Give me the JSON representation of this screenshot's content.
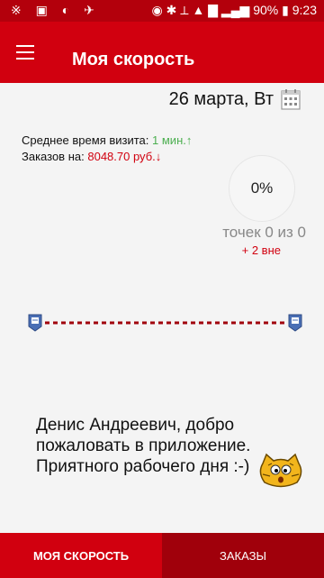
{
  "status_bar": {
    "battery": "90%",
    "time": "9:23"
  },
  "app_bar": {
    "title": "Моя скорость"
  },
  "date": {
    "text": "26 марта, Вт"
  },
  "stats": {
    "avg_visit_label": "Среднее время визита:",
    "avg_visit_value": "1 мин.↑",
    "orders_label": "Заказов на:",
    "orders_value": "8048.70 руб.↓"
  },
  "progress": {
    "percent_text": "0%",
    "percent": 0
  },
  "points": {
    "text": "точек 0 из 0",
    "extra": "+ 2 вне"
  },
  "greeting": {
    "text": "Денис Андреевич, добро пожаловать в приложение. Приятного рабочего дня :-)"
  },
  "tabs": [
    {
      "label": "МОЯ СКОРОСТЬ"
    },
    {
      "label": "ЗАКАЗЫ"
    }
  ],
  "colors": {
    "brand": "#d1000f",
    "positive": "#4caf50"
  }
}
